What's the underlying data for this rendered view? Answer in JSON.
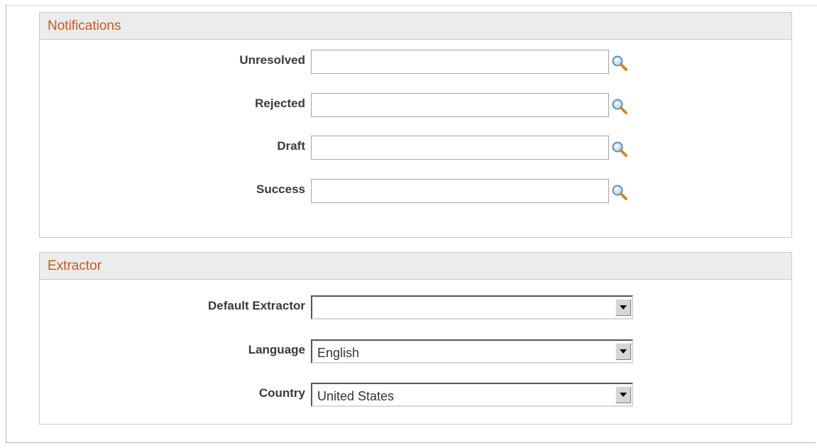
{
  "notifications": {
    "title": "Notifications",
    "fields": [
      {
        "label": "Unresolved",
        "value": ""
      },
      {
        "label": "Rejected",
        "value": ""
      },
      {
        "label": "Draft",
        "value": ""
      },
      {
        "label": "Success",
        "value": ""
      }
    ],
    "lookup_icon": "magnifier-icon"
  },
  "extractor": {
    "title": "Extractor",
    "fields": [
      {
        "label": "Default Extractor",
        "value": ""
      },
      {
        "label": "Language",
        "value": "English"
      },
      {
        "label": "Country",
        "value": "United States"
      }
    ],
    "dropdown_icon": "chevron-down-icon"
  },
  "colors": {
    "section_title": "#c25a1c",
    "header_bg": "#ececec",
    "label_text": "#3a3a3a"
  }
}
